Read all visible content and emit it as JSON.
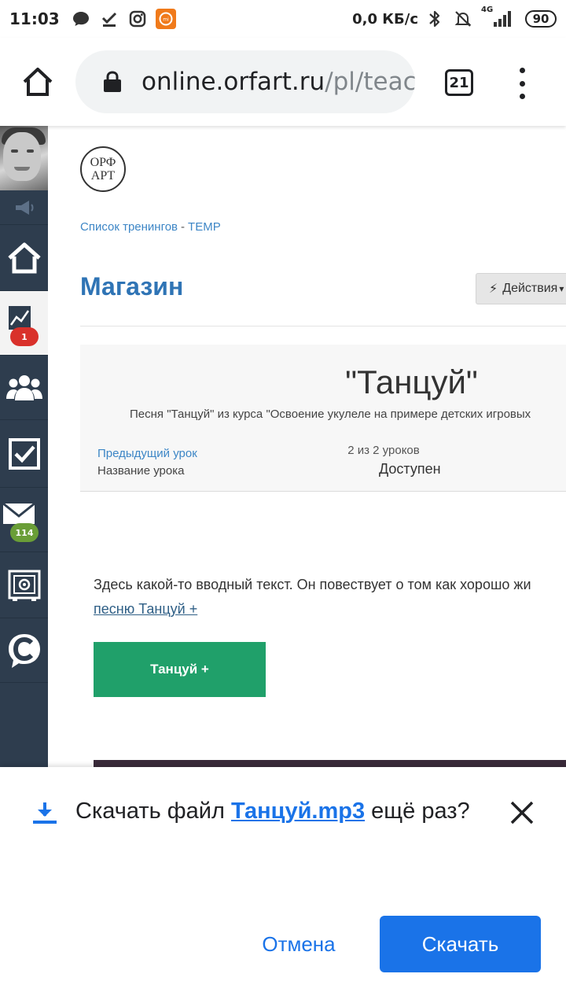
{
  "status_bar": {
    "time": "11:03",
    "net_speed": "0,0 КБ/с",
    "network": "4G",
    "battery": "90",
    "icons": [
      "chat-icon",
      "download-done-icon",
      "instagram-icon",
      "mi-app-icon",
      "bluetooth-icon",
      "mute-icon",
      "signal-icon"
    ]
  },
  "browser": {
    "url_host": "online.orfart.ru",
    "url_path": "/pl/teac",
    "tab_count": "21"
  },
  "sidebar": {
    "badges": {
      "tasks": "1",
      "messages": "114"
    },
    "items": [
      "avatar",
      "megaphone-icon",
      "home-icon",
      "chart-icon",
      "users-icon",
      "checkbox-icon",
      "mail-icon",
      "safe-icon",
      "chat-logo-icon"
    ]
  },
  "page": {
    "logo_line1": "ОРФ",
    "logo_line2": "АРТ",
    "breadcrumb": {
      "item1": "Список тренингов",
      "separator": "-",
      "item2": "TEMP"
    },
    "title": "Магазин",
    "actions_label": "Действия",
    "lesson": {
      "title": "\"Танцуй\"",
      "subtitle": "Песня \"Танцуй\" из курса \"Освоение укулеле на примере детских игровых",
      "prev_link": "Предыдущий урок",
      "name_label": "Название урока",
      "count": "2 из 2 уроков",
      "status": "Доступен"
    },
    "intro_text": "Здесь какой-то вводный текст. Он повествует о том как хорошо жи",
    "intro_link": "песню Танцуй +",
    "button_label": "Танцуй +"
  },
  "download_sheet": {
    "prefix": "Скачать файл ",
    "file_name": "Танцуй.mp3",
    "suffix": " ещё раз?",
    "cancel_label": "Отмена",
    "download_label": "Скачать"
  },
  "colors": {
    "accent_blue": "#1a73e8",
    "sidebar_bg": "#2e3d4e",
    "page_title": "#2f74b5",
    "green_button": "#20a06a"
  }
}
